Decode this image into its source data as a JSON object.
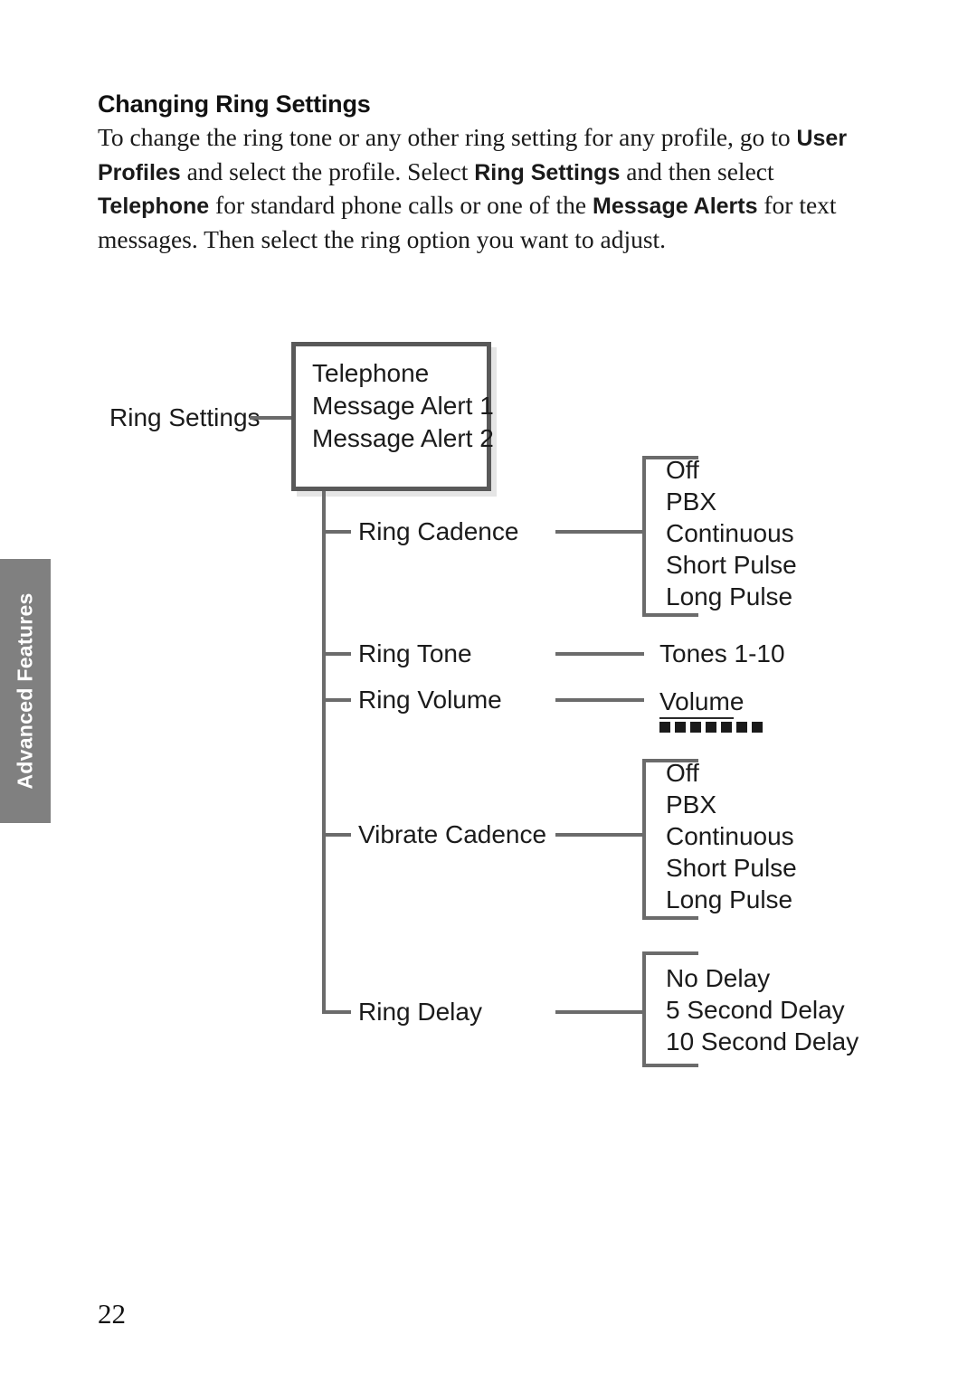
{
  "page": {
    "heading": "Changing Ring Settings",
    "number": "22",
    "side_tab_label": "Advanced Features",
    "body_parts": [
      {
        "text": "To change the ring tone or any other ring setting for any profile, go to ",
        "bold": false
      },
      {
        "text": "User Profiles",
        "bold": true
      },
      {
        "text": " and select the profile. Select ",
        "bold": false
      },
      {
        "text": "Ring Settings",
        "bold": true
      },
      {
        "text": " and then select ",
        "bold": false
      },
      {
        "text": "Telephone",
        "bold": true
      },
      {
        "text": " for standard phone calls or one of the ",
        "bold": false
      },
      {
        "text": "Message Alerts",
        "bold": true
      },
      {
        "text": " for text messages. Then select the ring option you want to adjust.",
        "bold": false
      }
    ]
  },
  "diagram": {
    "root_label": "Ring Settings",
    "root_box_items": [
      "Telephone",
      "Message Alert 1",
      "Message Alert 2"
    ],
    "branches": [
      {
        "label": "Ring Cadence"
      },
      {
        "label": "Ring Tone"
      },
      {
        "label": "Ring Volume"
      },
      {
        "label": "Vibrate Cadence"
      },
      {
        "label": "Ring Delay"
      }
    ],
    "options": {
      "ring_cadence": [
        "Off",
        "PBX",
        "Continuous",
        "Short Pulse",
        "Long Pulse"
      ],
      "ring_tone": [
        "Tones 1-10"
      ],
      "ring_volume": [
        "Volume"
      ],
      "vibrate_cadence": [
        "Off",
        "PBX",
        "Continuous",
        "Short Pulse",
        "Long Pulse"
      ],
      "ring_delay": [
        "No Delay",
        "5 Second Delay",
        "10 Second Delay"
      ]
    },
    "volume_level_blocks": 7,
    "colors": {
      "line": "#6b6b6b",
      "box_border": "#595959",
      "tab_background": "#808080",
      "text": "#1b1b1b"
    }
  }
}
